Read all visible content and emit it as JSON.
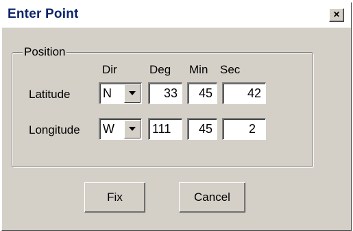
{
  "window": {
    "title": "Enter Point",
    "close_glyph": "×"
  },
  "position_group": {
    "legend": "Position",
    "headers": {
      "dir": "Dir",
      "deg": "Deg",
      "min": "Min",
      "sec": "Sec"
    },
    "latitude": {
      "label": "Latitude",
      "dir": "N",
      "deg": "33",
      "min": "45",
      "sec": "42"
    },
    "longitude": {
      "label": "Longitude",
      "dir": "W",
      "deg": "111",
      "min": "45",
      "sec": "2"
    }
  },
  "buttons": {
    "fix": "Fix",
    "cancel": "Cancel"
  },
  "colors": {
    "face": "#d4d0c8",
    "title_text": "#0a246a",
    "field_bg": "#ffffff"
  }
}
